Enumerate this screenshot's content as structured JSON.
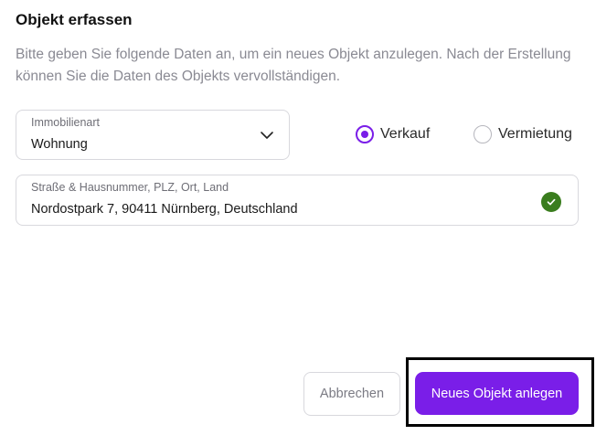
{
  "dialog": {
    "title": "Objekt erfassen",
    "subtitle": "Bitte geben Sie folgende Daten an, um ein neues Objekt anzulegen. Nach der Erstellung können Sie die Daten des Objekts vervollständigen."
  },
  "property_type": {
    "label": "Immobilienart",
    "value": "Wohnung"
  },
  "transaction": {
    "options": [
      {
        "label": "Verkauf",
        "checked": true
      },
      {
        "label": "Vermietung",
        "checked": false
      }
    ]
  },
  "address": {
    "label": "Straße & Hausnummer, PLZ, Ort, Land",
    "value": "Nordostpark 7, 90411 Nürnberg, Deutschland",
    "valid": true
  },
  "actions": {
    "cancel_label": "Abbrechen",
    "submit_label": "Neues Objekt anlegen"
  },
  "colors": {
    "accent": "#7a1ee8",
    "success": "#3a7d1e",
    "muted_text": "#8a8a93",
    "border": "#d8d8dd"
  },
  "icons": {
    "select_toggle": "chevron-down-icon",
    "address_status": "check-circle-icon"
  }
}
